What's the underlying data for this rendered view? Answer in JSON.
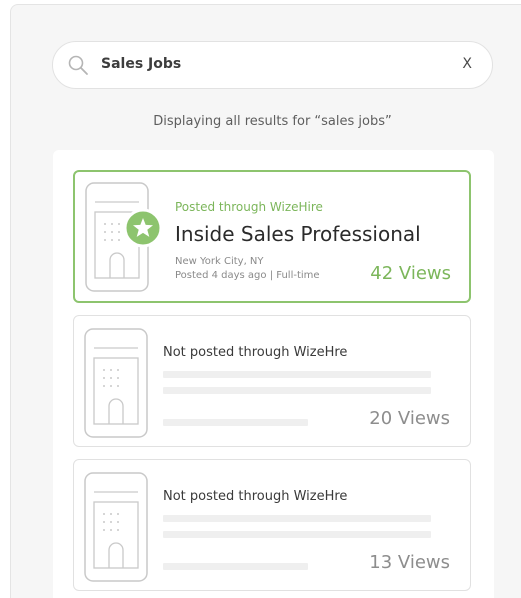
{
  "search": {
    "query": "Sales Jobs",
    "clear_label": "X",
    "icon": "search-icon"
  },
  "results": {
    "caption": "Displaying all results for “sales jobs”"
  },
  "jobs": [
    {
      "source": "Posted through WizeHire",
      "title": "Inside Sales Professional",
      "location": "New York City, NY",
      "meta": "Posted 4 days ago | Full-time",
      "views": "42 Views",
      "featured": true,
      "icons": [
        "building-icon",
        "star-badge-icon"
      ]
    },
    {
      "source": "Not posted through WizeHre",
      "views": "20 Views",
      "featured": false,
      "icons": [
        "building-icon"
      ]
    },
    {
      "source": "Not posted through WizeHre",
      "views": "13 Views",
      "featured": false,
      "icons": [
        "building-icon"
      ]
    }
  ],
  "colors": {
    "accent_green": "#8dc46e",
    "accent_text_green": "#7cb65b",
    "background": "#f6f6f6",
    "card_border": "#e1e1e1",
    "skeleton": "#efefef"
  }
}
